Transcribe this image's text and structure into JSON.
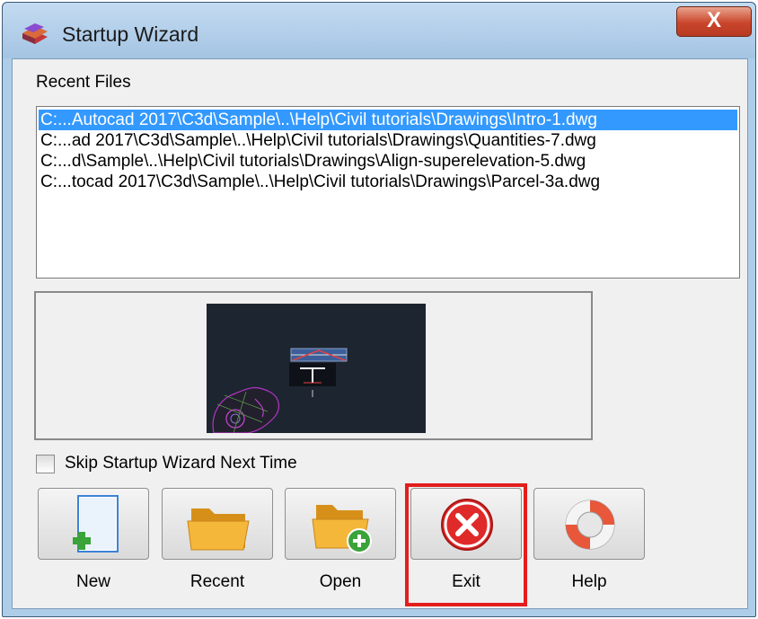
{
  "window": {
    "title": "Startup Wizard",
    "close_glyph": "X",
    "icon": "autocad-civil3d-icon"
  },
  "recent_files": {
    "label": "Recent Files",
    "items": [
      "C:...Autocad 2017\\C3d\\Sample\\..\\Help\\Civil tutorials\\Drawings\\Intro-1.dwg",
      "C:...ad 2017\\C3d\\Sample\\..\\Help\\Civil tutorials\\Drawings\\Quantities-7.dwg",
      "C:...d\\Sample\\..\\Help\\Civil tutorials\\Drawings\\Align-superelevation-5.dwg",
      "C:...tocad 2017\\C3d\\Sample\\..\\Help\\Civil tutorials\\Drawings\\Parcel-3a.dwg"
    ],
    "selected_index": 0
  },
  "preview": {
    "background": "#1d2530"
  },
  "skip_wizard": {
    "label": "Skip Startup Wizard Next Time",
    "checked": false
  },
  "buttons": [
    {
      "label": "New",
      "icon": "new-document-icon"
    },
    {
      "label": "Recent",
      "icon": "folder-icon"
    },
    {
      "label": "Open",
      "icon": "open-folder-icon"
    },
    {
      "label": "Exit",
      "icon": "exit-icon"
    },
    {
      "label": "Help",
      "icon": "lifebuoy-icon"
    }
  ],
  "colors": {
    "selection": "#3399ff",
    "highlight_box": "#e31d1d",
    "title_bar": "#aecde8",
    "close_button": "#c9452b"
  }
}
